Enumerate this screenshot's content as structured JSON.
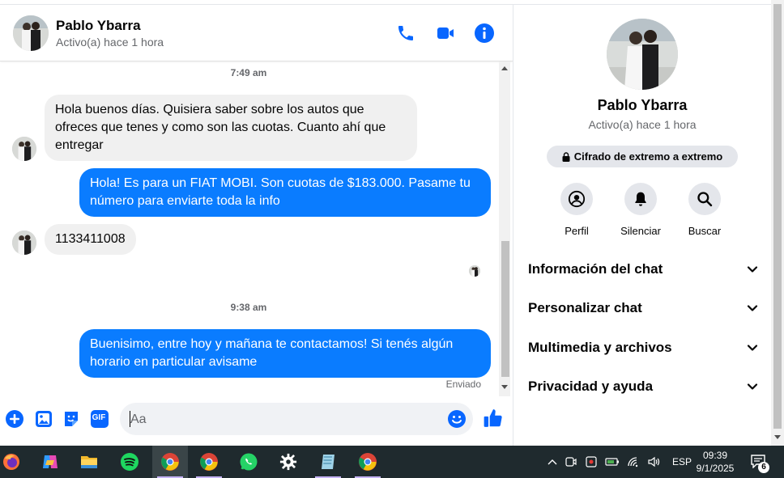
{
  "contact": {
    "name": "Pablo Ybarra",
    "status": "Activo(a) hace 1 hora"
  },
  "messages": {
    "time1": "7:49 am",
    "msg1": "Hola buenos días. Quisiera saber sobre los autos que ofreces que tenes y como son las cuotas. Cuanto ahí que entregar",
    "msg2": "Hola! Es para un FIAT MOBI. Son cuotas de $183.000. Pasame tu número para enviarte toda la info",
    "msg3": "1133411008",
    "time2": "9:38 am",
    "msg4": "Buenisimo, entre hoy y mañana te contactamos! Si tenés algún horario en particular avisame",
    "sent": "Enviado"
  },
  "composer": {
    "placeholder": "Aa",
    "gif_label": "GIF"
  },
  "info_panel": {
    "encryption": "Cifrado de extremo a extremo",
    "actions": [
      "Perfil",
      "Silenciar",
      "Buscar"
    ],
    "sections": [
      "Información del chat",
      "Personalizar chat",
      "Multimedia y archivos",
      "Privacidad y ayuda"
    ]
  },
  "taskbar": {
    "language": "ESP",
    "time": "09:39",
    "date": "9/1/2025",
    "notifications": "6"
  },
  "colors": {
    "accent": "#0a7cff",
    "icon_blue": "#0866ff",
    "bubble_in": "#f0f0f0",
    "taskbar": "#1f2a2e"
  }
}
